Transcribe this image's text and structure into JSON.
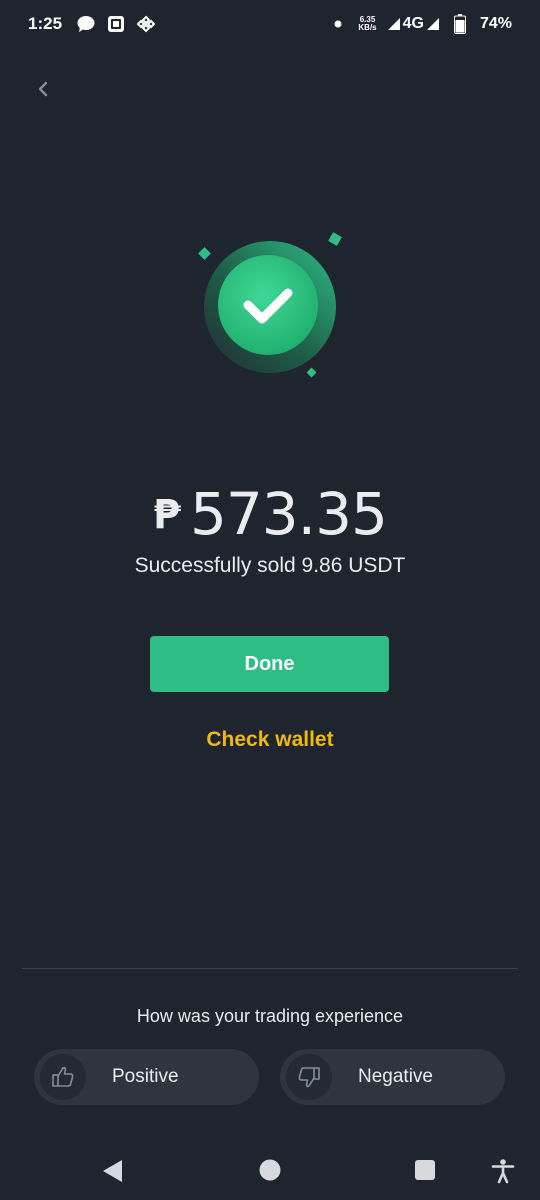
{
  "status_bar": {
    "time": "1:25",
    "net_speed_value": "6.35",
    "net_speed_unit": "KB/s",
    "network": "4G",
    "battery": "74%"
  },
  "result": {
    "currency_symbol": "₱",
    "amount": "573.35",
    "message": "Successfully sold  9.86 USDT"
  },
  "actions": {
    "done_label": "Done",
    "check_wallet_label": "Check wallet"
  },
  "feedback": {
    "question": "How was your trading experience",
    "positive_label": "Positive",
    "negative_label": "Negative"
  },
  "colors": {
    "background": "#1f252e",
    "accent_green": "#2ebd85",
    "link_yellow": "#f0b90b"
  }
}
